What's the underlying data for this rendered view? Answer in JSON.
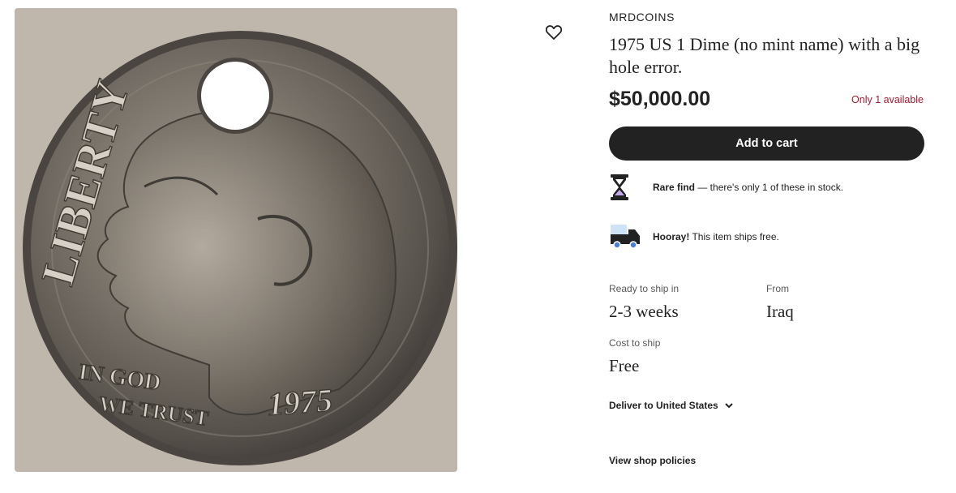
{
  "product": {
    "shop_name": "MRDCOINS",
    "title": "1975 US 1 Dime (no mint name) with a big hole error.",
    "price": "$50,000.00",
    "availability": "Only 1 available",
    "add_to_cart_label": "Add to cart",
    "photo": {
      "alt": "1975 US dime with a hole near the top",
      "coin_text_liberty": "LIBERTY",
      "coin_text_in_god": "IN GOD",
      "coin_text_we_trust": "WE TRUST",
      "coin_text_year": "1975"
    }
  },
  "features": {
    "rare": {
      "icon": "hourglass-icon",
      "bold": "Rare find",
      "text": " — there's only 1 of these in stock."
    },
    "shipping": {
      "icon": "truck-icon",
      "bold": "Hooray!",
      "text": " This item ships free."
    }
  },
  "shipping_info": {
    "ready_label": "Ready to ship in",
    "ready_value": "2-3 weeks",
    "from_label": "From",
    "from_value": "Iraq",
    "cost_label": "Cost to ship",
    "cost_value": "Free"
  },
  "deliver_to": {
    "label": "Deliver to United States",
    "icon": "chevron-down-icon"
  },
  "policies_link": "View shop policies",
  "colors": {
    "button_bg": "#222222",
    "availability": "#a61a2e",
    "photo_bg": "#bfb6ac"
  }
}
